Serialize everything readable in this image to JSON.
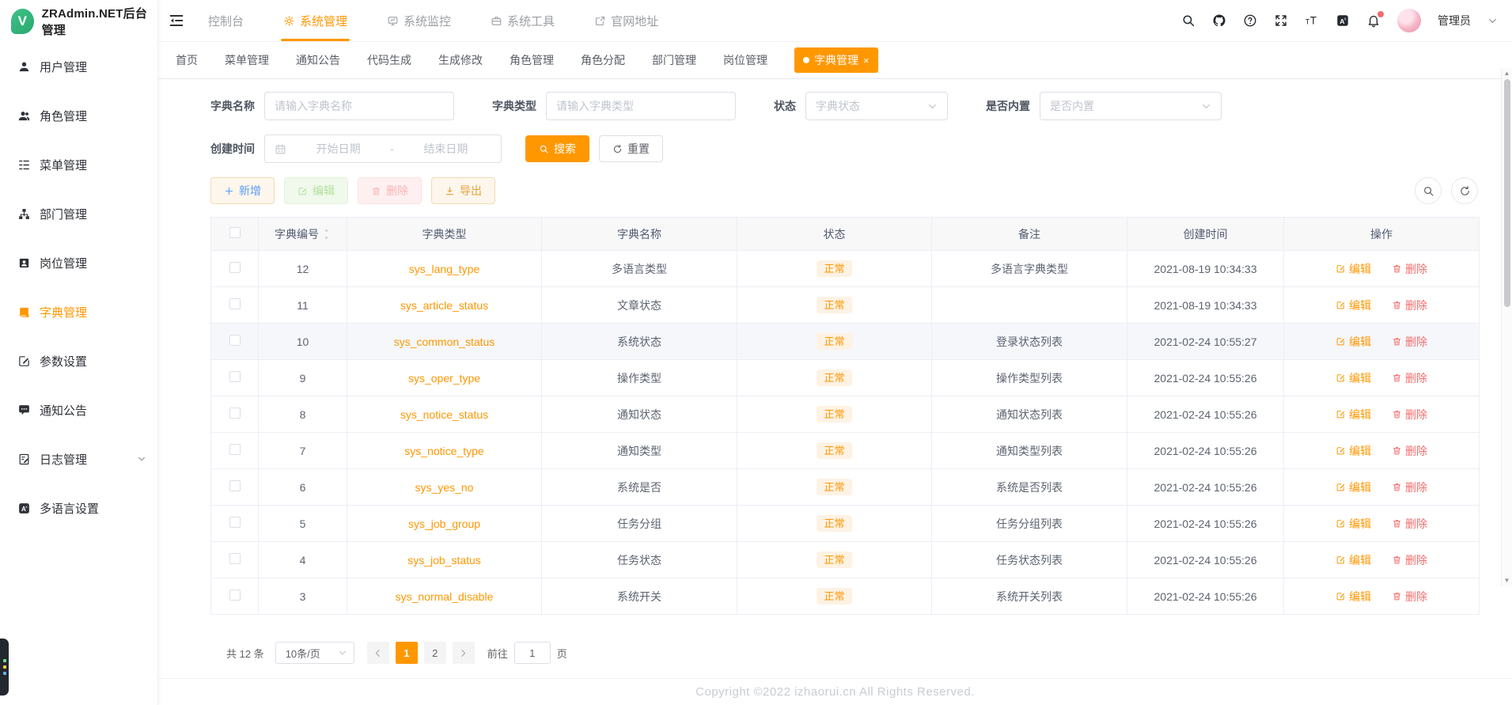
{
  "app": {
    "title": "ZRAdmin.NET后台管理",
    "logo_letter": "V"
  },
  "topnav": {
    "items": [
      {
        "label": "控制台",
        "icon": ""
      },
      {
        "label": "系统管理",
        "icon": "gear",
        "active": true
      },
      {
        "label": "系统监控",
        "icon": "monitor"
      },
      {
        "label": "系统工具",
        "icon": "tool"
      },
      {
        "label": "官网地址",
        "icon": "link"
      }
    ]
  },
  "userbar": {
    "username": "管理员",
    "icon_names": [
      "search-icon",
      "github-icon",
      "help-icon",
      "fullscreen-icon",
      "font-size-icon",
      "translate-icon",
      "bell-icon",
      "avatar",
      "chevron-down-icon"
    ]
  },
  "tabs": {
    "items": [
      "首页",
      "菜单管理",
      "通知公告",
      "代码生成",
      "生成修改",
      "角色管理",
      "角色分配",
      "部门管理",
      "岗位管理"
    ],
    "active": {
      "label": "字典管理",
      "close": "×"
    }
  },
  "sidebar": {
    "items": [
      {
        "label": "用户管理",
        "icon": "user"
      },
      {
        "label": "角色管理",
        "icon": "users"
      },
      {
        "label": "菜单管理",
        "icon": "tree"
      },
      {
        "label": "部门管理",
        "icon": "dept"
      },
      {
        "label": "岗位管理",
        "icon": "post"
      },
      {
        "label": "字典管理",
        "icon": "dict",
        "active": true
      },
      {
        "label": "参数设置",
        "icon": "param"
      },
      {
        "label": "通知公告",
        "icon": "notice"
      },
      {
        "label": "日志管理",
        "icon": "log",
        "expandable": true
      },
      {
        "label": "多语言设置",
        "icon": "lang"
      }
    ]
  },
  "filters": {
    "dict_name": {
      "label": "字典名称",
      "placeholder": "请输入字典名称"
    },
    "dict_type": {
      "label": "字典类型",
      "placeholder": "请输入字典类型"
    },
    "status": {
      "label": "状态",
      "placeholder": "字典状态"
    },
    "builtin": {
      "label": "是否内置",
      "placeholder": "是否内置"
    },
    "create_time": {
      "label": "创建时间",
      "start_placeholder": "开始日期",
      "separator": "-",
      "end_placeholder": "结束日期"
    },
    "search_label": "搜索",
    "reset_label": "重置"
  },
  "toolbar": {
    "add_label": "新增",
    "edit_label": "编辑",
    "delete_label": "删除",
    "export_label": "导出"
  },
  "table": {
    "columns": [
      "字典编号",
      "字典类型",
      "字典名称",
      "状态",
      "备注",
      "创建时间",
      "操作"
    ],
    "row_actions": {
      "edit": "编辑",
      "delete": "删除"
    },
    "rows": [
      {
        "id": "12",
        "type": "sys_lang_type",
        "name": "多语言类型",
        "status": "正常",
        "remark": "多语言字典类型",
        "created": "2021-08-19 10:34:33"
      },
      {
        "id": "11",
        "type": "sys_article_status",
        "name": "文章状态",
        "status": "正常",
        "remark": "",
        "created": "2021-08-19 10:34:33"
      },
      {
        "id": "10",
        "type": "sys_common_status",
        "name": "系统状态",
        "status": "正常",
        "remark": "登录状态列表",
        "created": "2021-02-24 10:55:27",
        "highlight": true
      },
      {
        "id": "9",
        "type": "sys_oper_type",
        "name": "操作类型",
        "status": "正常",
        "remark": "操作类型列表",
        "created": "2021-02-24 10:55:26"
      },
      {
        "id": "8",
        "type": "sys_notice_status",
        "name": "通知状态",
        "status": "正常",
        "remark": "通知状态列表",
        "created": "2021-02-24 10:55:26"
      },
      {
        "id": "7",
        "type": "sys_notice_type",
        "name": "通知类型",
        "status": "正常",
        "remark": "通知类型列表",
        "created": "2021-02-24 10:55:26"
      },
      {
        "id": "6",
        "type": "sys_yes_no",
        "name": "系统是否",
        "status": "正常",
        "remark": "系统是否列表",
        "created": "2021-02-24 10:55:26"
      },
      {
        "id": "5",
        "type": "sys_job_group",
        "name": "任务分组",
        "status": "正常",
        "remark": "任务分组列表",
        "created": "2021-02-24 10:55:26"
      },
      {
        "id": "4",
        "type": "sys_job_status",
        "name": "任务状态",
        "status": "正常",
        "remark": "任务状态列表",
        "created": "2021-02-24 10:55:26"
      },
      {
        "id": "3",
        "type": "sys_normal_disable",
        "name": "系统开关",
        "status": "正常",
        "remark": "系统开关列表",
        "created": "2021-02-24 10:55:26"
      }
    ]
  },
  "pagination": {
    "total_text": "共 12 条",
    "page_size": "10条/页",
    "pages": [
      "1",
      "2"
    ],
    "active_page": "1",
    "goto_label": "前往",
    "goto_value": "1",
    "page_unit": "页"
  },
  "footer": {
    "copyright": "Copyright ©2022 izhaorui.cn All Rights Reserved."
  },
  "colors": {
    "accent": "#ff9700",
    "link": "#ff9700",
    "status_badge_bg": "#fdf2e3",
    "status_badge_text": "#ff9700",
    "delete_link": "#f56c6c",
    "add_text": "#5a9cf8",
    "export_text": "#e6a23c",
    "edit_disabled_text": "#b3e19d",
    "delete_disabled_text": "#f9b4b4",
    "logo_green": "#35b57c",
    "notification_dot": "#f56c6c"
  }
}
